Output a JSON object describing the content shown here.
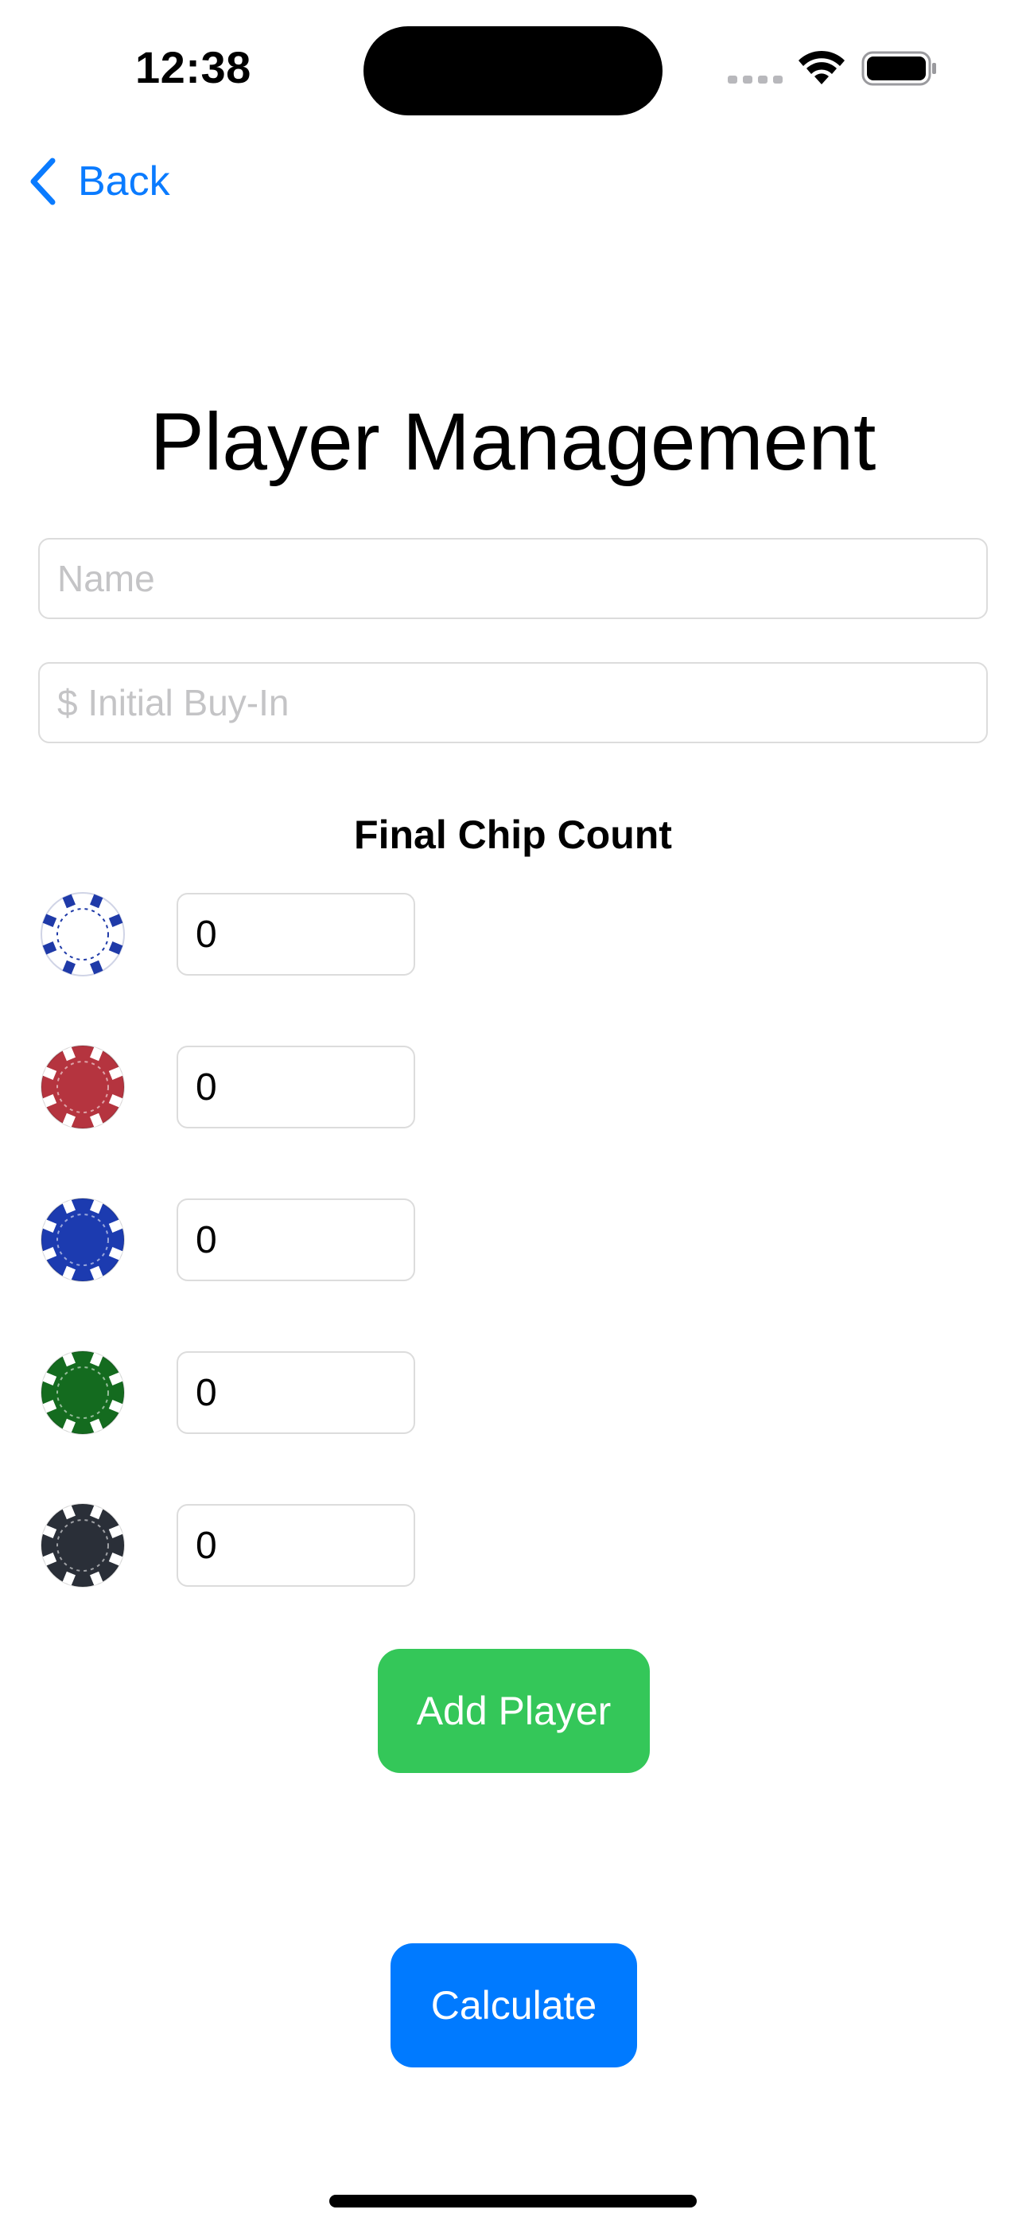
{
  "status_bar": {
    "time": "12:38"
  },
  "nav": {
    "back_label": "Back",
    "accent": "#0a7bff"
  },
  "title": "Player Management",
  "form": {
    "name_placeholder": "Name",
    "name_value": "",
    "buyin_placeholder": "$ Initial Buy-In",
    "buyin_value": ""
  },
  "chip_section": {
    "label": "Final Chip Count",
    "chips": [
      {
        "color": "white",
        "face": "#ffffff",
        "stripe": "#1f3aa8",
        "value": "0"
      },
      {
        "color": "red",
        "face": "#b5343f",
        "stripe": "#ffffff",
        "value": "0"
      },
      {
        "color": "blue",
        "face": "#1c3bb0",
        "stripe": "#ffffff",
        "value": "0"
      },
      {
        "color": "green",
        "face": "#146b1f",
        "stripe": "#ffffff",
        "value": "0"
      },
      {
        "color": "black",
        "face": "#2a2f38",
        "stripe": "#ffffff",
        "value": "0"
      }
    ]
  },
  "buttons": {
    "add_player": "Add Player",
    "add_player_color": "#34c759",
    "calculate": "Calculate",
    "calculate_color": "#007aff"
  }
}
